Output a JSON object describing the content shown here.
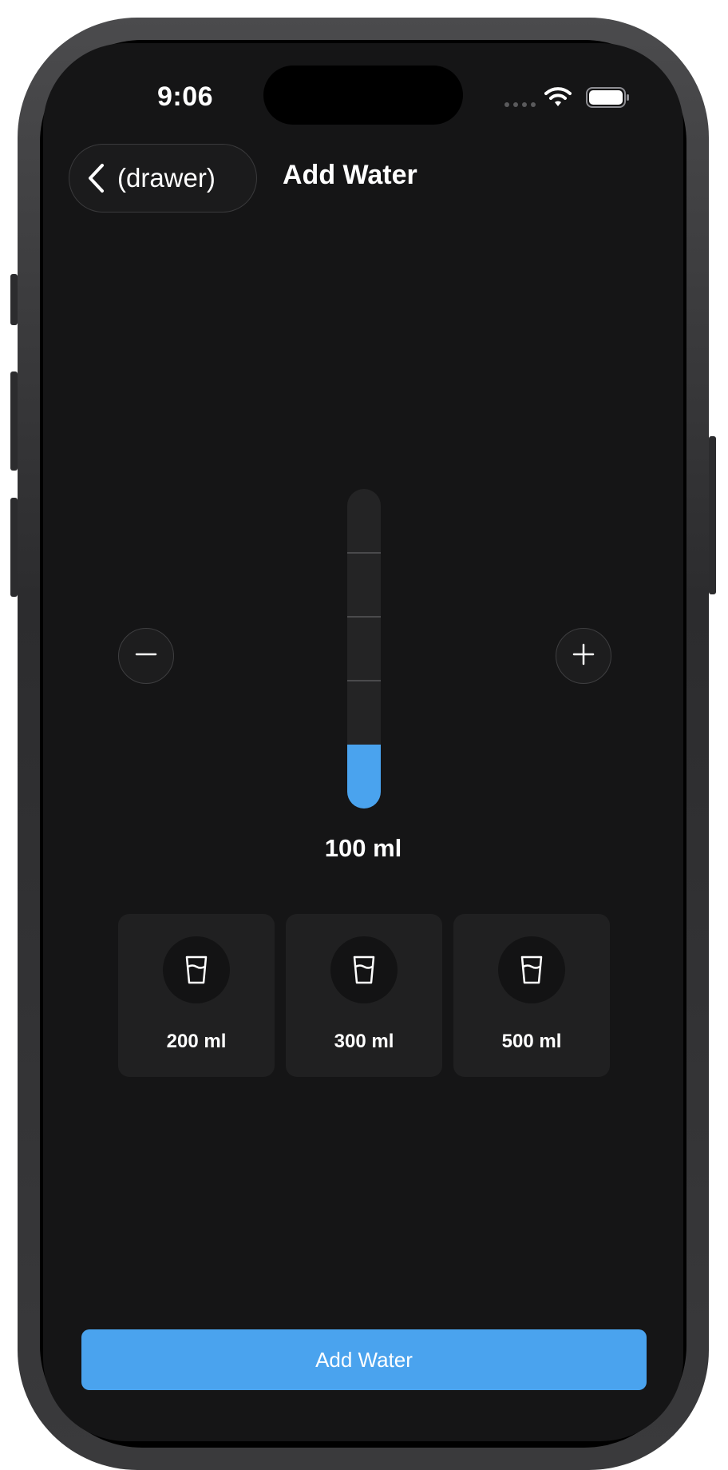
{
  "status_bar": {
    "time": "9:06",
    "icons": [
      "cellular-signal-icon",
      "wifi-icon",
      "battery-icon"
    ]
  },
  "nav": {
    "back_label": "(drawer)",
    "back_icon": "chevron-left-icon",
    "title": "Add Water"
  },
  "gauge": {
    "amount_label": "100 ml",
    "fill_fraction": 0.2,
    "fill_color": "#4aa3ee"
  },
  "controls": {
    "decrease_icon": "minus-icon",
    "increase_icon": "plus-icon"
  },
  "presets": [
    {
      "label": "200 ml",
      "icon": "glass-icon"
    },
    {
      "label": "300 ml",
      "icon": "glass-icon"
    },
    {
      "label": "500 ml",
      "icon": "glass-icon"
    }
  ],
  "primary_action": {
    "label": "Add Water",
    "color": "#4aa3ee"
  },
  "theme": {
    "background": "#151516",
    "accent": "#4aa3ee"
  }
}
